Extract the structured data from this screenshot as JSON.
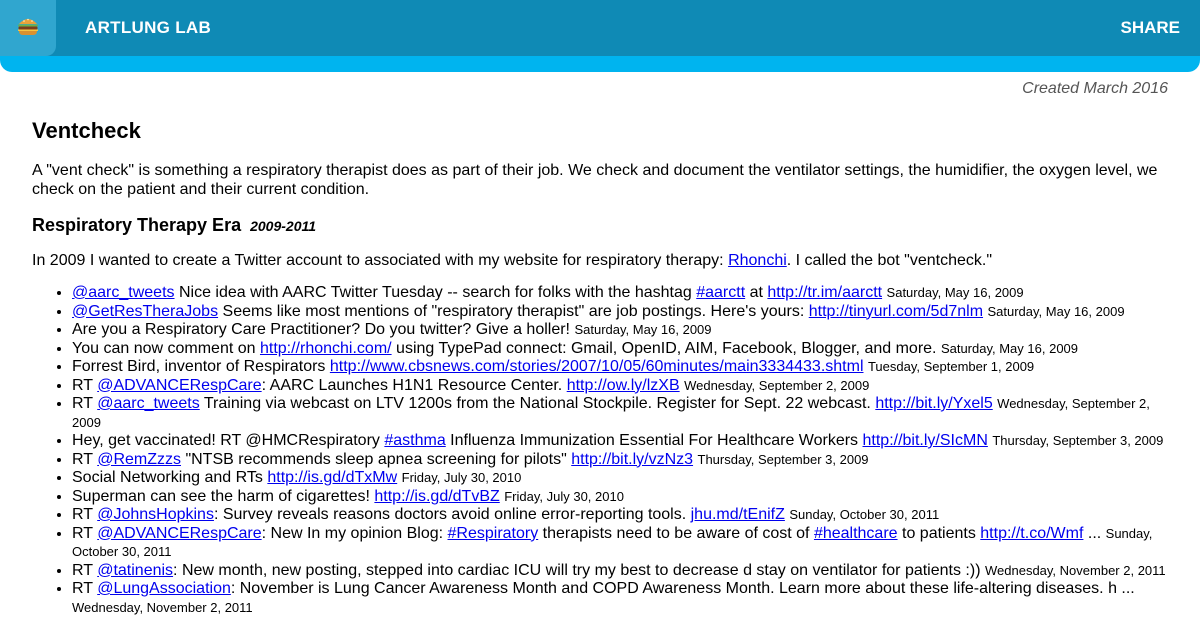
{
  "header": {
    "brand": "ARTLUNG LAB",
    "share": "SHARE"
  },
  "created": "Created March 2016",
  "title": "Ventcheck",
  "intro": "A \"vent check\" is something a respiratory therapist does as part of their job. We check and document the ventilator settings, the humidifier, the oxygen level, we check on the patient and their current condition.",
  "era": {
    "title": "Respiratory Therapy Era",
    "years": "2009-2011"
  },
  "paragraph": {
    "before": "In 2009 I wanted to create a Twitter account to associated with my website for respiratory therapy: ",
    "link": "Rhonchi",
    "after": ". I called the bot \"ventcheck.\""
  },
  "tweets": [
    {
      "parts": [
        {
          "l": "@aarc_tweets"
        },
        {
          "t": " Nice idea with AARC Twitter Tuesday -- search for folks with the hashtag "
        },
        {
          "l": "#aarctt"
        },
        {
          "t": " at "
        },
        {
          "l": "http://tr.im/aarctt"
        }
      ],
      "date": "Saturday, May 16, 2009"
    },
    {
      "parts": [
        {
          "l": "@GetResTheraJobs"
        },
        {
          "t": " Seems like most mentions of \"respiratory therapist\" are job postings. Here's yours: "
        },
        {
          "l": "http://tinyurl.com/5d7nlm"
        }
      ],
      "date": "Saturday, May 16, 2009"
    },
    {
      "parts": [
        {
          "t": "Are you a Respiratory Care Practitioner? Do you twitter? Give a holler!"
        }
      ],
      "date": "Saturday, May 16, 2009"
    },
    {
      "parts": [
        {
          "t": "You can now comment on "
        },
        {
          "l": "http://rhonchi.com/"
        },
        {
          "t": " using TypePad connect: Gmail, OpenID, AIM, Facebook, Blogger, and more."
        }
      ],
      "date": "Saturday, May 16, 2009"
    },
    {
      "parts": [
        {
          "t": "Forrest Bird, inventor of Respirators "
        },
        {
          "l": "http://www.cbsnews.com/stories/2007/10/05/60minutes/main3334433.shtml"
        }
      ],
      "date": "Tuesday, September 1, 2009"
    },
    {
      "parts": [
        {
          "t": "RT "
        },
        {
          "l": "@ADVANCERespCare"
        },
        {
          "t": ": AARC Launches H1N1 Resource Center. "
        },
        {
          "l": "http://ow.ly/lzXB"
        }
      ],
      "date": "Wednesday, September 2, 2009"
    },
    {
      "parts": [
        {
          "t": "RT "
        },
        {
          "l": "@aarc_tweets"
        },
        {
          "t": " Training via webcast on LTV 1200s from the National Stockpile. Register for Sept. 22 webcast. "
        },
        {
          "l": "http://bit.ly/Yxel5"
        }
      ],
      "date": "Wednesday, September 2, 2009"
    },
    {
      "parts": [
        {
          "t": "Hey, get vaccinated! RT @HMCRespiratory "
        },
        {
          "l": "#asthma"
        },
        {
          "t": " Influenza Immunization Essential For Healthcare Workers "
        },
        {
          "l": "http://bit.ly/SIcMN"
        }
      ],
      "date": "Thursday, September 3, 2009"
    },
    {
      "parts": [
        {
          "t": "RT "
        },
        {
          "l": "@RemZzzs"
        },
        {
          "t": " \"NTSB recommends sleep apnea screening for pilots\" "
        },
        {
          "l": "http://bit.ly/vzNz3"
        }
      ],
      "date": "Thursday, September 3, 2009"
    },
    {
      "parts": [
        {
          "t": "Social Networking and RTs "
        },
        {
          "l": "http://is.gd/dTxMw"
        }
      ],
      "date": "Friday, July 30, 2010"
    },
    {
      "parts": [
        {
          "t": "Superman can see the harm of cigarettes! "
        },
        {
          "l": "http://is.gd/dTvBZ"
        }
      ],
      "date": "Friday, July 30, 2010"
    },
    {
      "parts": [
        {
          "t": "RT "
        },
        {
          "l": "@JohnsHopkins"
        },
        {
          "t": ": Survey reveals reasons doctors avoid online error-reporting tools. "
        },
        {
          "l": "jhu.md/tEnifZ"
        }
      ],
      "date": "Sunday, October 30, 2011"
    },
    {
      "parts": [
        {
          "t": "RT "
        },
        {
          "l": "@ADVANCERespCare"
        },
        {
          "t": ": New In my opinion Blog: "
        },
        {
          "l": "#Respiratory"
        },
        {
          "t": " therapists need to be aware of cost of "
        },
        {
          "l": "#healthcare"
        },
        {
          "t": " to patients "
        },
        {
          "l": "http://t.co/Wmf"
        },
        {
          "t": " ..."
        }
      ],
      "date": "Sunday, October 30, 2011"
    },
    {
      "parts": [
        {
          "t": "RT "
        },
        {
          "l": "@tatinenis"
        },
        {
          "t": ": New month, new posting, stepped into cardiac ICU will try my best to decrease d stay on ventilator for patients :))"
        }
      ],
      "date": "Wednesday, November 2, 2011"
    },
    {
      "parts": [
        {
          "t": "RT "
        },
        {
          "l": "@LungAssociation"
        },
        {
          "t": ": November is Lung Cancer Awareness Month and COPD Awareness Month. Learn more about these life-altering diseases. h ..."
        }
      ],
      "date": "Wednesday, November 2, 2011"
    }
  ]
}
